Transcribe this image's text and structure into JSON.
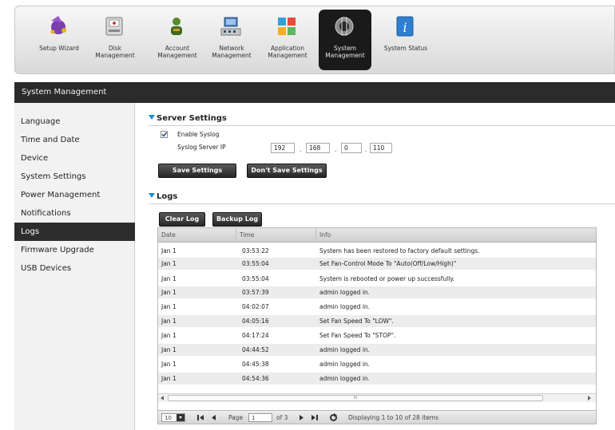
{
  "toolbar": {
    "items": [
      {
        "label": "Setup Wizard",
        "icon": "wizard-icon"
      },
      {
        "label": "Disk Management",
        "icon": "disk-icon"
      },
      {
        "label": "Account Management",
        "icon": "account-icon"
      },
      {
        "label": "Network Management",
        "icon": "network-icon"
      },
      {
        "label": "Application Management",
        "icon": "application-icon"
      },
      {
        "label": "System Management",
        "icon": "system-icon"
      },
      {
        "label": "System Status",
        "icon": "info-icon"
      }
    ],
    "active": "System Management"
  },
  "header": {
    "title": "System Management"
  },
  "sidebar": {
    "items": [
      {
        "label": "Language"
      },
      {
        "label": "Time and Date"
      },
      {
        "label": "Device"
      },
      {
        "label": "System Settings"
      },
      {
        "label": "Power Management"
      },
      {
        "label": "Notifications"
      },
      {
        "label": "Logs"
      },
      {
        "label": "Firmware Upgrade"
      },
      {
        "label": "USB Devices"
      }
    ],
    "active": "Logs"
  },
  "server": {
    "title": "Server Settings",
    "enable_label": "Enable Syslog",
    "enable_checked": true,
    "ip_label": "Syslog Server IP",
    "ip": [
      "192",
      "168",
      "0",
      "110"
    ],
    "ip_sep": ".",
    "save_label": "Save Settings",
    "dontsave_label": "Don't Save Settings"
  },
  "logs": {
    "title": "Logs",
    "clear_label": "Clear Log",
    "backup_label": "Backup Log",
    "columns": [
      "Date",
      "Time",
      "Info"
    ],
    "rows": [
      [
        "Jan 1",
        "03:53:22",
        "System has been restored to factory default settings."
      ],
      [
        "Jan 1",
        "03:55:04",
        "Set Fan-Control Mode To \"Auto(Off/Low/High)\""
      ],
      [
        "Jan 1",
        "03:55:04",
        "System is rebooted or power up successfully."
      ],
      [
        "Jan 1",
        "03:57:39",
        "admin logged in."
      ],
      [
        "Jan 1",
        "04:02:07",
        "admin logged in."
      ],
      [
        "Jan 1",
        "04:05:16",
        "Set Fan Speed To \"LOW\"."
      ],
      [
        "Jan 1",
        "04:17:24",
        "Set Fan Speed To \"STOP\"."
      ],
      [
        "Jan 1",
        "04:44:52",
        "admin logged in."
      ],
      [
        "Jan 1",
        "04:45:38",
        "admin logged in."
      ],
      [
        "Jan 1",
        "04:54:36",
        "admin logged in."
      ]
    ],
    "scroll_mark": "III"
  },
  "pager": {
    "page_size": "10",
    "page_label": "Page",
    "page": "1",
    "of_label": "of 3",
    "display": "Displaying 1 to 10 of 28 items"
  }
}
